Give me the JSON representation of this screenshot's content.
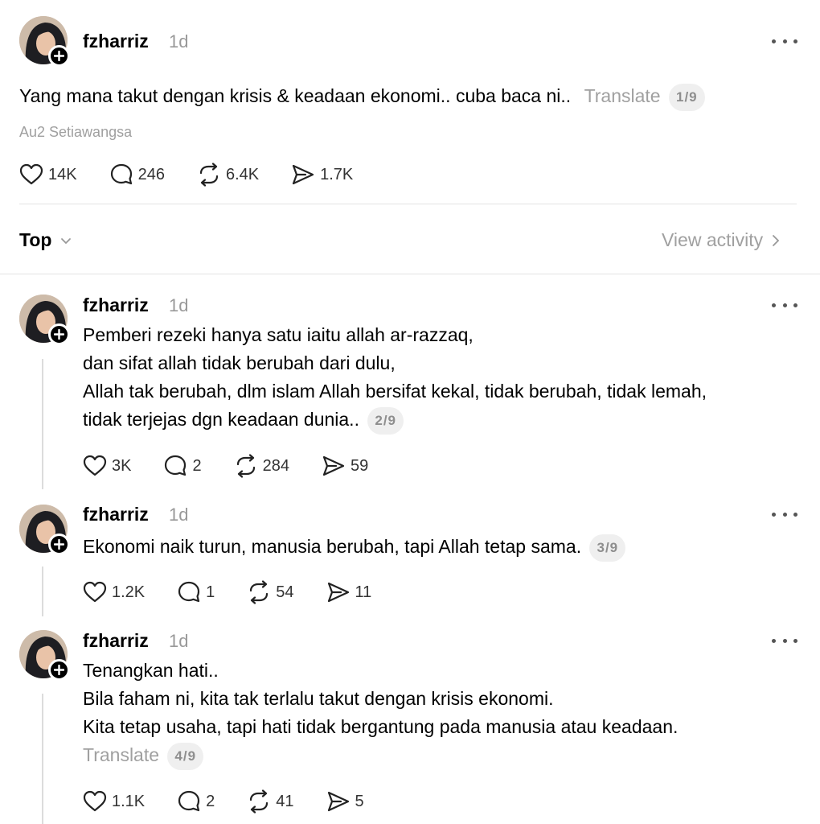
{
  "main_post": {
    "username": "fzharriz",
    "time": "1d",
    "text": "Yang mana takut dengan krisis & keadaan ekonomi.. cuba baca ni..",
    "translate": "Translate",
    "pager": "1/9",
    "location": "Au2 Setiawangsa",
    "likes": "14K",
    "replies": "246",
    "reposts": "6.4K",
    "shares": "1.7K"
  },
  "sort": {
    "label": "Top",
    "view_activity": "View activity"
  },
  "replies": [
    {
      "username": "fzharriz",
      "time": "1d",
      "lines": [
        "Pemberi rezeki hanya satu iaitu allah ar-razzaq,",
        "dan sifat allah tidak berubah dari dulu,",
        "Allah tak berubah, dlm islam Allah bersifat kekal, tidak berubah, tidak lemah,",
        "tidak terjejas dgn keadaan dunia.."
      ],
      "pager": "2/9",
      "likes": "3K",
      "replies": "2",
      "reposts": "284",
      "shares": "59"
    },
    {
      "username": "fzharriz",
      "time": "1d",
      "lines": [
        "Ekonomi naik turun, manusia berubah, tapi Allah tetap sama."
      ],
      "pager": "3/9",
      "likes": "1.2K",
      "replies": "1",
      "reposts": "54",
      "shares": "11"
    },
    {
      "username": "fzharriz",
      "time": "1d",
      "lines": [
        "Tenangkan hati..",
        "Bila faham ni, kita tak terlalu takut dengan krisis ekonomi.",
        "Kita tetap usaha, tapi hati tidak bergantung pada manusia atau keadaan."
      ],
      "translate": "Translate",
      "pager": "4/9",
      "likes": "1.1K",
      "replies": "2",
      "reposts": "41",
      "shares": "5"
    }
  ]
}
